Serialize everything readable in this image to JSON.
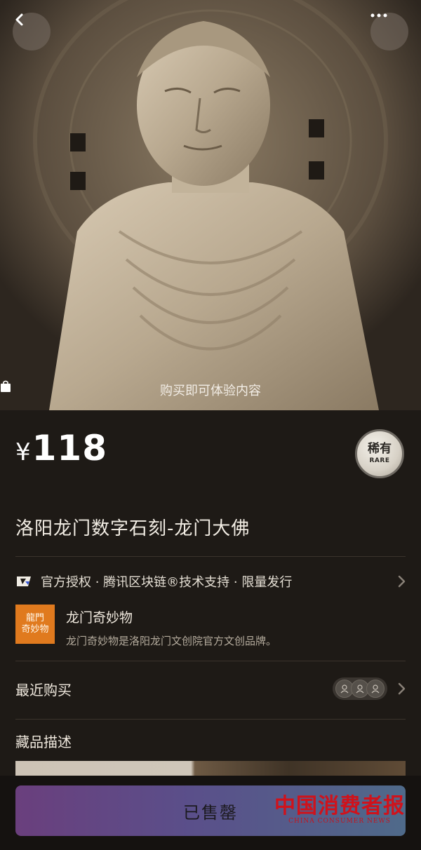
{
  "hero": {
    "caption": "购买即可体验内容",
    "back_icon": "chevron-left-icon",
    "more_icon": "more-horizontal-icon",
    "caption_icon": "shopping-bag-icon"
  },
  "price": {
    "currency": "¥",
    "value": "118"
  },
  "badge": {
    "main": "稀有",
    "sub": "RARE"
  },
  "title": "洛阳龙门数字石刻-龙门大佛",
  "auth": {
    "text": "官方授权 · 腾讯区块链®技术支持 · 限量发行",
    "icon": "tencent-logo-icon"
  },
  "brand": {
    "logo_line1": "龍門",
    "logo_line2": "奇妙物",
    "name": "龙门奇妙物",
    "description": "龙门奇妙物是洛阳龙门文创院官方文创品牌。"
  },
  "recent": {
    "label": "最近购买",
    "avatar_count": 3
  },
  "collection": {
    "label": "藏品描述"
  },
  "action": {
    "sold_label": "已售罄"
  },
  "watermark": {
    "main": "中国消费者报",
    "sub": "CHINA CONSUMER NEWS"
  },
  "colors": {
    "accent_orange": "#e07a1e",
    "background": "#1e1a16",
    "button_gradient_start": "#6a3f7d",
    "button_gradient_end": "#4f6a8a"
  }
}
